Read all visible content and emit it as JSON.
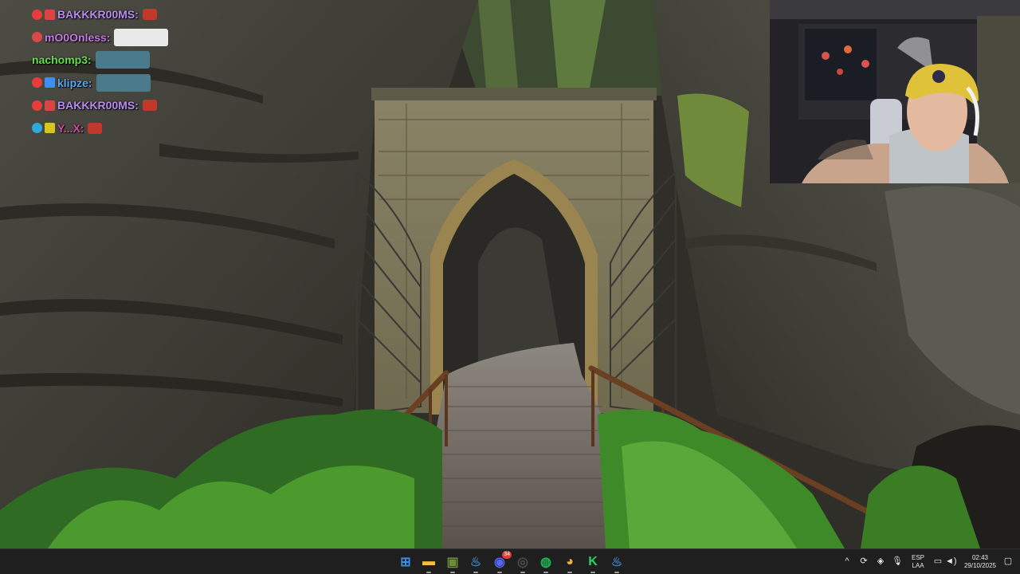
{
  "chat": {
    "messages": [
      {
        "username": "BAKKKR00MS:",
        "name_color": "#b98cf0",
        "badges": [
          "#e83b3b",
          "#d94444"
        ],
        "emote_color": "#c0392b",
        "emote_kind": "small"
      },
      {
        "username": "mO0Onless:",
        "name_color": "#c879e8",
        "badges": [
          "#d84a4a"
        ],
        "emote_color": "#e9e9e9",
        "emote_kind": "wide"
      },
      {
        "username": "nachomp3:",
        "name_color": "#60e24a",
        "badges": [],
        "emote_color": "#4a7a8c",
        "emote_kind": "wide"
      },
      {
        "username": "klipze:",
        "name_color": "#5aa6f0",
        "badges": [
          "#e83b3b",
          "#3e8ef7"
        ],
        "emote_color": "#4a7a8c",
        "emote_kind": "wide"
      },
      {
        "username": "BAKKKR00MS:",
        "name_color": "#b98cf0",
        "badges": [
          "#e83b3b",
          "#d94444"
        ],
        "emote_color": "#c0392b",
        "emote_kind": "small"
      },
      {
        "username": "Y...X:",
        "name_color": "#cf4fa8",
        "badges": [
          "#2fa8e0",
          "#d6c51f"
        ],
        "emote_color": "#c0392b",
        "emote_kind": "small"
      }
    ]
  },
  "taskbar": {
    "apps": [
      {
        "name": "start-button",
        "color": "#3a8ee6",
        "glyph": "⊞"
      },
      {
        "name": "file-explorer-icon",
        "color": "#f2c037",
        "glyph": "▬"
      },
      {
        "name": "game-launcher-icon",
        "color": "#6b8c3a",
        "glyph": "▣"
      },
      {
        "name": "steam-icon",
        "color": "#3b7fb8",
        "glyph": "♨"
      },
      {
        "name": "discord-icon",
        "color": "#5865f2",
        "glyph": "◉"
      },
      {
        "name": "obs-icon",
        "color": "#4d4d4d",
        "glyph": "◎"
      },
      {
        "name": "spotify-icon",
        "color": "#1db954",
        "glyph": "◍"
      },
      {
        "name": "chrome-icon",
        "color": "#e9b533",
        "glyph": "◕"
      },
      {
        "name": "kick-icon",
        "color": "#25d366",
        "glyph": "K"
      },
      {
        "name": "steam-icon-2",
        "color": "#3b7fb8",
        "glyph": "♨"
      }
    ],
    "discord_badge": "34",
    "language_top": "ESP",
    "language_bottom": "LAA",
    "time": "02:43",
    "date": "29/10/2025"
  }
}
